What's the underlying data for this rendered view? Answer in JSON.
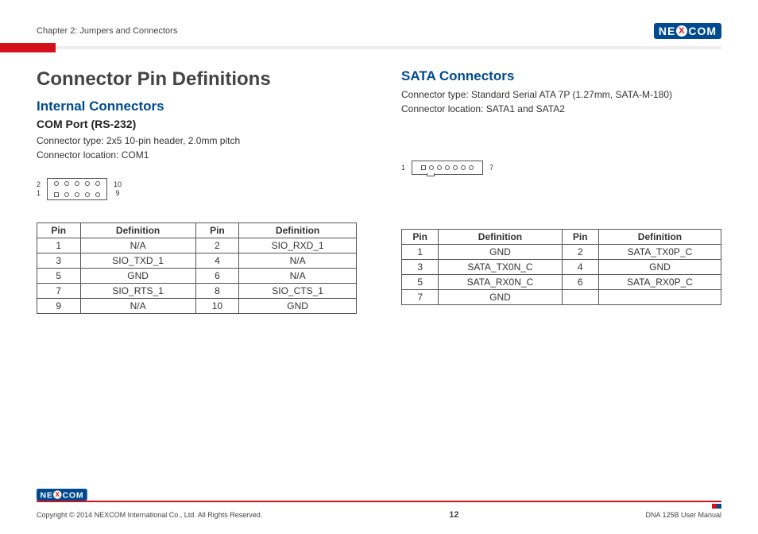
{
  "header": {
    "chapter": "Chapter 2: Jumpers and Connectors",
    "logo_left": "NE",
    "logo_x": "X",
    "logo_right": "COM"
  },
  "left": {
    "main_title": "Connector Pin Definitions",
    "sub1": "Internal Connectors",
    "sub2": "COM Port (RS-232)",
    "desc_line1": "Connector type: 2x5 10-pin header, 2.0mm pitch",
    "desc_line2": "Connector location: COM1",
    "diagram_labels": {
      "tl": "2",
      "bl": "1",
      "tr": "10",
      "br": "9"
    },
    "th": {
      "pin": "Pin",
      "def": "Definition"
    },
    "rows": [
      {
        "p1": "1",
        "d1": "N/A",
        "p2": "2",
        "d2": "SIO_RXD_1"
      },
      {
        "p1": "3",
        "d1": "SIO_TXD_1",
        "p2": "4",
        "d2": "N/A"
      },
      {
        "p1": "5",
        "d1": "GND",
        "p2": "6",
        "d2": "N/A"
      },
      {
        "p1": "7",
        "d1": "SIO_RTS_1",
        "p2": "8",
        "d2": "SIO_CTS_1"
      },
      {
        "p1": "9",
        "d1": "N/A",
        "p2": "10",
        "d2": "GND"
      }
    ]
  },
  "right": {
    "sub1": "SATA Connectors",
    "desc_line1": "Connector type: Standard Serial ATA 7P (1.27mm, SATA-M-180)",
    "desc_line2": "Connector location: SATA1 and SATA2",
    "diagram_labels": {
      "l": "1",
      "r": "7"
    },
    "th": {
      "pin": "Pin",
      "def": "Definition"
    },
    "rows": [
      {
        "p1": "1",
        "d1": "GND",
        "p2": "2",
        "d2": "SATA_TX0P_C"
      },
      {
        "p1": "3",
        "d1": "SATA_TX0N_C",
        "p2": "4",
        "d2": "GND"
      },
      {
        "p1": "5",
        "d1": "SATA_RX0N_C",
        "p2": "6",
        "d2": "SATA_RX0P_C"
      },
      {
        "p1": "7",
        "d1": "GND",
        "p2": "",
        "d2": ""
      }
    ]
  },
  "footer": {
    "copyright": "Copyright © 2014 NEXCOM International Co., Ltd. All Rights Reserved.",
    "page": "12",
    "manual": "DNA 125B User Manual"
  }
}
